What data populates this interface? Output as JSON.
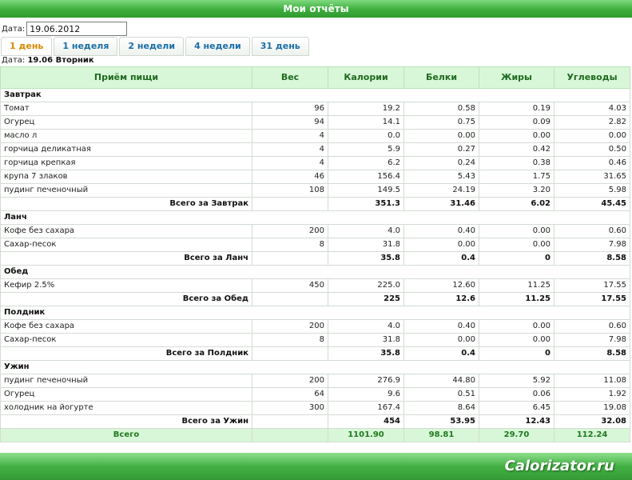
{
  "header": {
    "title": "Мои отчёты"
  },
  "date_filter": {
    "label": "Дата:",
    "value": "19.06.2012"
  },
  "tabs": [
    {
      "label": "1 день"
    },
    {
      "label": "1 неделя"
    },
    {
      "label": "2 недели"
    },
    {
      "label": "4 недели"
    },
    {
      "label": "31 день"
    }
  ],
  "day_info": {
    "label": "Дата:",
    "value": "19.06 Вторник"
  },
  "table": {
    "columns": [
      "Приём пищи",
      "Вес",
      "Калории",
      "Белки",
      "Жиры",
      "Углеводы"
    ],
    "meals": [
      {
        "name": "Завтрак",
        "items": [
          [
            "Томат",
            "96",
            "19.2",
            "0.58",
            "0.19",
            "4.03"
          ],
          [
            "Огурец",
            "94",
            "14.1",
            "0.75",
            "0.09",
            "2.82"
          ],
          [
            "масло л",
            "4",
            "0.0",
            "0.00",
            "0.00",
            "0.00"
          ],
          [
            "горчица деликатная",
            "4",
            "5.9",
            "0.27",
            "0.42",
            "0.50"
          ],
          [
            "горчица крепкая",
            "4",
            "6.2",
            "0.24",
            "0.38",
            "0.46"
          ],
          [
            "крупа 7 злаков",
            "46",
            "156.4",
            "5.43",
            "1.75",
            "31.65"
          ],
          [
            "пудинг печеночный",
            "108",
            "149.5",
            "24.19",
            "3.20",
            "5.98"
          ]
        ],
        "total": [
          "Всего за Завтрак",
          "351.3",
          "31.46",
          "6.02",
          "45.45"
        ]
      },
      {
        "name": "Ланч",
        "items": [
          [
            "Кофе без сахара",
            "200",
            "4.0",
            "0.40",
            "0.00",
            "0.60"
          ],
          [
            "Сахар-песок",
            "8",
            "31.8",
            "0.00",
            "0.00",
            "7.98"
          ]
        ],
        "total": [
          "Всего за Ланч",
          "35.8",
          "0.4",
          "0",
          "8.58"
        ]
      },
      {
        "name": "Обед",
        "items": [
          [
            "Кефир 2.5%",
            "450",
            "225.0",
            "12.60",
            "11.25",
            "17.55"
          ]
        ],
        "total": [
          "Всего за Обед",
          "225",
          "12.6",
          "11.25",
          "17.55"
        ]
      },
      {
        "name": "Полдник",
        "items": [
          [
            "Кофе без сахара",
            "200",
            "4.0",
            "0.40",
            "0.00",
            "0.60"
          ],
          [
            "Сахар-песок",
            "8",
            "31.8",
            "0.00",
            "0.00",
            "7.98"
          ]
        ],
        "total": [
          "Всего за Полдник",
          "35.8",
          "0.4",
          "0",
          "8.58"
        ]
      },
      {
        "name": "Ужин",
        "items": [
          [
            "пудинг печеночный",
            "200",
            "276.9",
            "44.80",
            "5.92",
            "11.08"
          ],
          [
            "Огурец",
            "64",
            "9.6",
            "0.51",
            "0.06",
            "1.92"
          ],
          [
            "холодник на йогурте",
            "300",
            "167.4",
            "8.64",
            "6.45",
            "19.08"
          ]
        ],
        "total": [
          "Всего за Ужин",
          "454",
          "53.95",
          "12.43",
          "32.08"
        ]
      }
    ],
    "grand_total": [
      "Всего",
      "",
      "1101.90",
      "98.81",
      "29.70",
      "112.24"
    ]
  },
  "footer": {
    "logo": "Calorizator.ru"
  },
  "colors": {
    "accent_green": "#3dae3d",
    "header_fill": "#d8f7d8",
    "tab_active": "#d98a00",
    "tab_link": "#1a6ea8"
  }
}
